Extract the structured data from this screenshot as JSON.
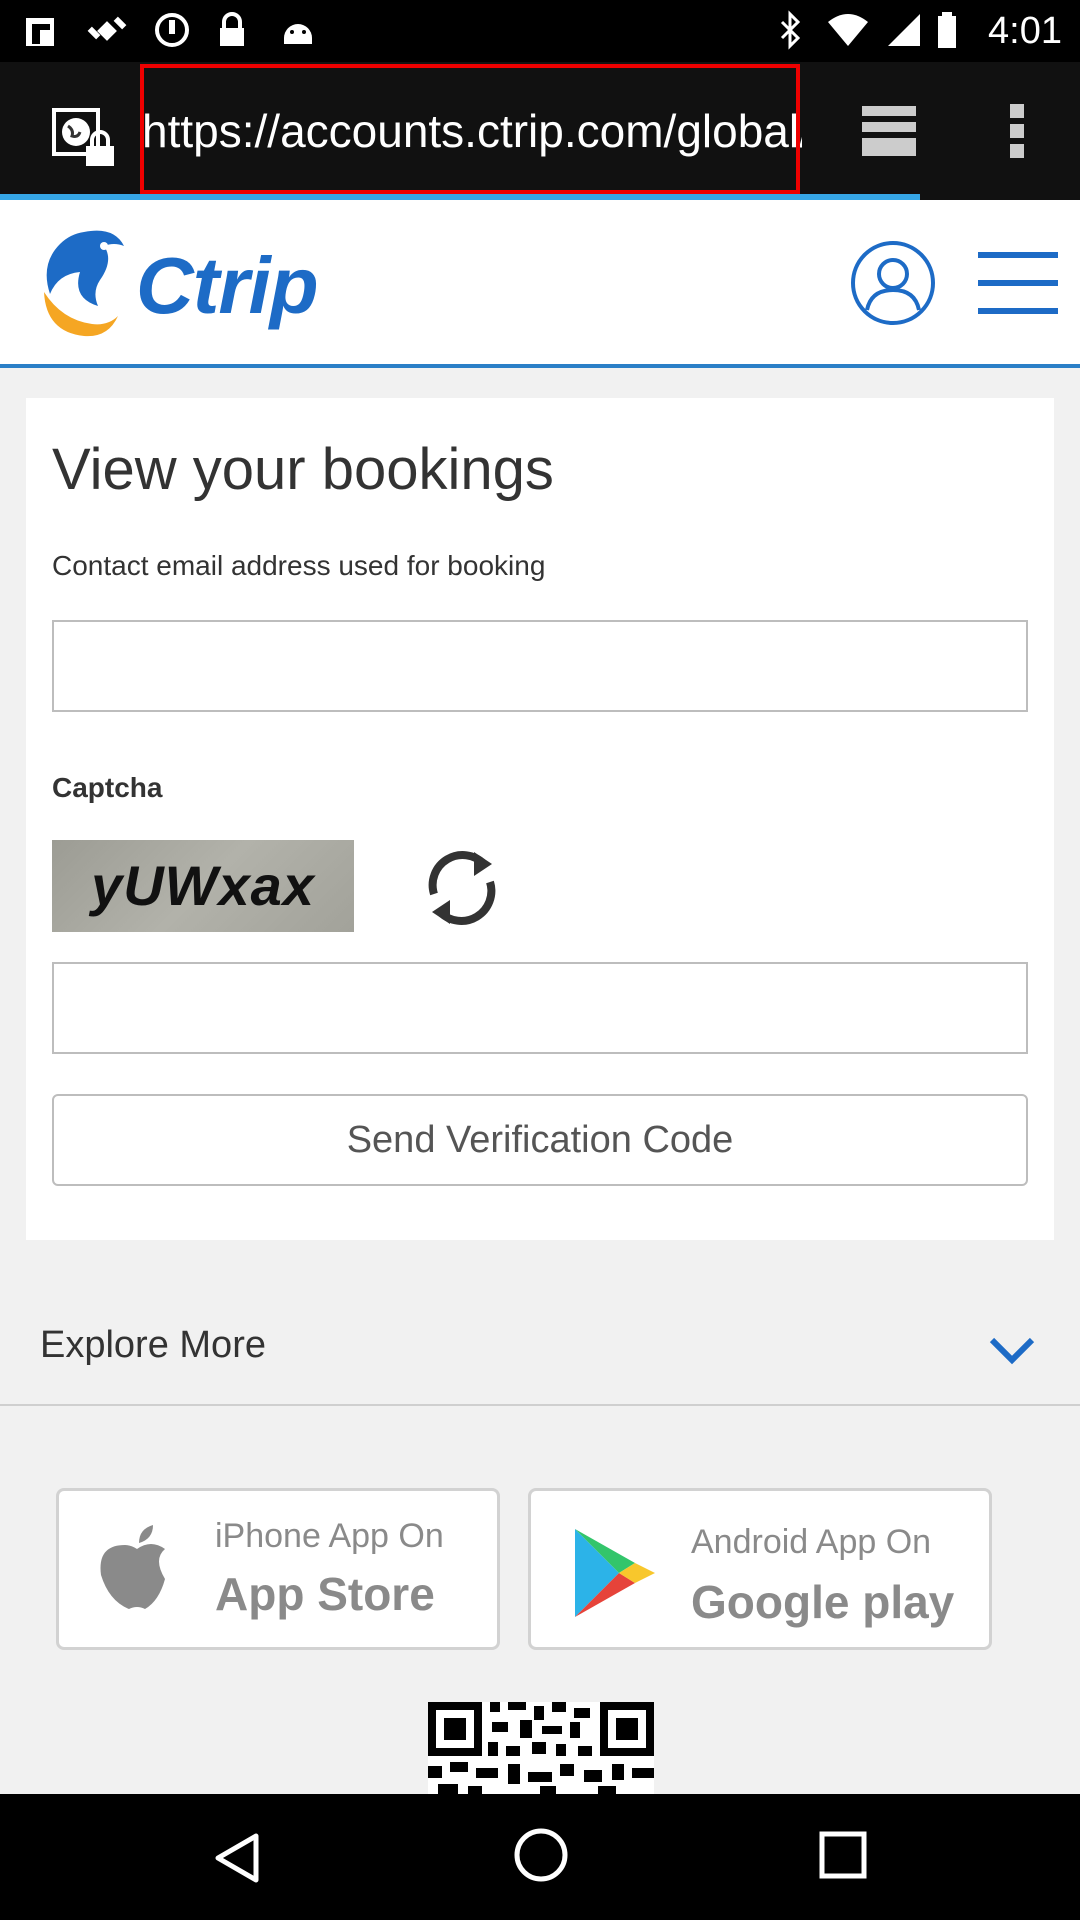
{
  "status_bar": {
    "time": "4:01",
    "icons": [
      "fake-gps-icon",
      "satellite-icon",
      "sync-icon",
      "lock-icon",
      "android-icon",
      "bluetooth-icon",
      "wifi-icon",
      "signal-icon",
      "battery-icon"
    ]
  },
  "browser": {
    "url": "https://accounts.ctrip.com/global/",
    "site_icon": "secure-site-icon",
    "tabs_icon": "tabs-icon",
    "menu_icon": "overflow-menu-icon",
    "highlight_color": "#e00000"
  },
  "site_header": {
    "logo_text": "Ctrip",
    "brand_color": "#1d6bc6",
    "user_icon": "user-account-icon",
    "menu_icon": "hamburger-menu-icon"
  },
  "booking": {
    "title": "View your bookings",
    "email_label": "Contact email address used for booking",
    "email_value": "",
    "captcha_label": "Captcha",
    "captcha_text": "yUWxax",
    "captcha_value": "",
    "refresh_icon": "refresh-icon",
    "send_button": "Send Verification Code"
  },
  "explore": {
    "label": "Explore More",
    "chevron_icon": "chevron-down-icon"
  },
  "stores": {
    "apple": {
      "small": "iPhone App On",
      "big": "App Store",
      "icon": "apple-icon"
    },
    "google": {
      "small": "Android App On",
      "big": "Google play",
      "icon": "google-play-icon"
    }
  },
  "nav_bar": {
    "back_icon": "back-icon",
    "home_icon": "home-icon",
    "recents_icon": "recents-icon"
  }
}
